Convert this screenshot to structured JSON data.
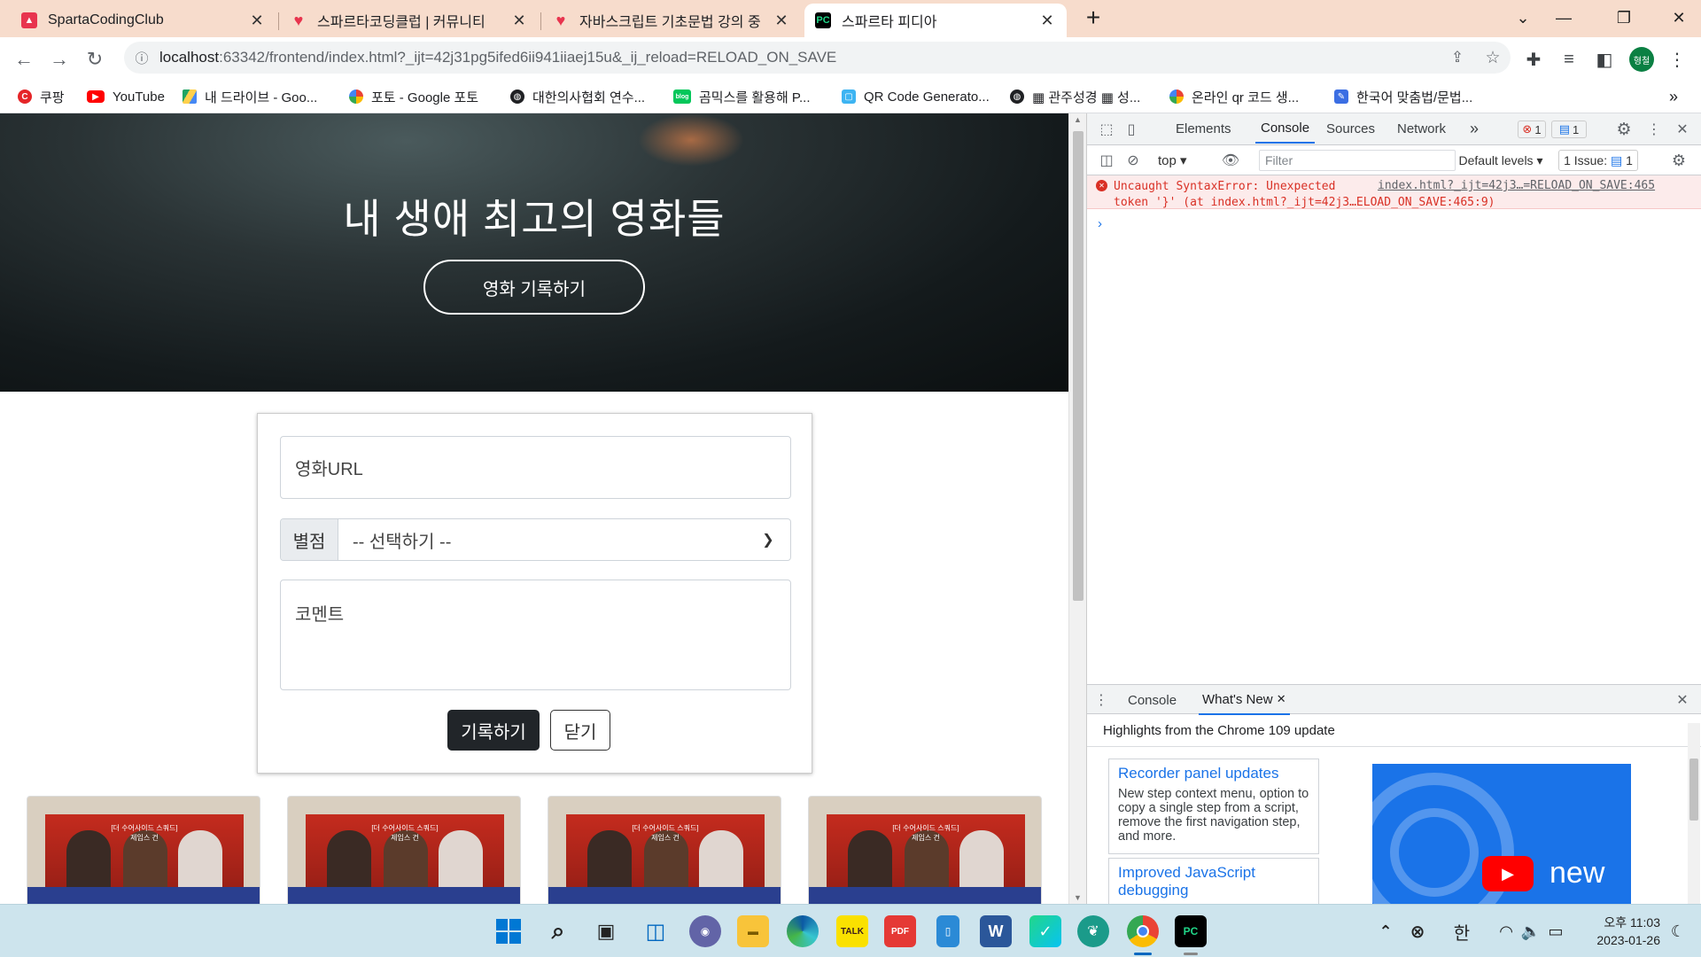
{
  "browser": {
    "tabs": [
      {
        "title": "SpartaCodingClub",
        "favicon": "sparta-icon",
        "color": "#e8344e"
      },
      {
        "title": "스파르타코딩클럽 | 커뮤니티",
        "favicon": "heart-icon",
        "color": "#e8344e"
      },
      {
        "title": "자바스크립트 기초문법 강의 중",
        "favicon": "heart-icon",
        "color": "#e8344e"
      },
      {
        "title": "스파르타 피디아",
        "favicon": "pycharm-icon",
        "color": "#21d789"
      }
    ],
    "new_tab": "+",
    "url_host": "localhost",
    "url_rest": ":63342/frontend/index.html?_ijt=42j31pg5ifed6ii941iiaej15u&_ij_reload=RELOAD_ON_SAVE",
    "profile_initial": "형철",
    "bookmarks": [
      {
        "label": "쿠팡",
        "icon": "coupang-icon",
        "color": "#e52528"
      },
      {
        "label": "YouTube",
        "icon": "youtube-icon",
        "color": "#ff0000"
      },
      {
        "label": "내 드라이브 - Goo...",
        "icon": "drive-icon",
        "color": "#1fa463"
      },
      {
        "label": "포토 - Google 포토",
        "icon": "photos-icon",
        "color": "#fbbc04"
      },
      {
        "label": "대한의사협회 연수...",
        "icon": "globe-icon",
        "color": "#202124"
      },
      {
        "label": "곰믹스를 활용해 P...",
        "icon": "blog-icon",
        "color": "#03c75a"
      },
      {
        "label": "QR Code Generato...",
        "icon": "qr-icon",
        "color": "#3db4f2"
      },
      {
        "label": "▦ 관주성경 ▦ 성...",
        "icon": "globe-icon",
        "color": "#202124"
      },
      {
        "label": "온라인 qr 코드 생...",
        "icon": "qr-flower-icon",
        "color": "#ea4335"
      },
      {
        "label": "한국어 맞춤법/문법...",
        "icon": "spell-icon",
        "color": "#3b6ee3"
      }
    ],
    "bookmarks_more": "»"
  },
  "page": {
    "hero_title": "내 생애 최고의 영화들",
    "hero_button": "영화 기록하기",
    "form": {
      "url_placeholder": "영화URL",
      "star_label": "별점",
      "star_selected": "-- 선택하기 --",
      "comment_placeholder": "코멘트",
      "save_button": "기록하기",
      "close_button": "닫기"
    },
    "poster_text": "[더 수어사이드 스쿼드] 제임스 건"
  },
  "devtools": {
    "tabs": [
      "Elements",
      "Console",
      "Sources",
      "Network"
    ],
    "active_tab": "Console",
    "more": "»",
    "error_count": "1",
    "message_count": "1",
    "context": "top",
    "filter_placeholder": "Filter",
    "levels": "Default levels",
    "issues_label": "1 Issue:",
    "issues_count": "1",
    "error_message": "Uncaught SyntaxError: Unexpected\ntoken '}' (at index.html?_ijt=42j3…ELOAD_ON_SAVE:465:9)",
    "error_source": "index.html?_ijt=42j3…=RELOAD_ON_SAVE:465",
    "drawer_tabs": [
      "Console",
      "What's New"
    ],
    "drawer_heading": "Highlights from the Chrome 109 update",
    "cards": [
      {
        "title": "Recorder panel updates",
        "desc": "New step context menu, option to copy a single step from a script, remove the first navigation step, and more."
      },
      {
        "title": "Improved JavaScript debugging",
        "desc": ""
      }
    ],
    "video_badge": "new"
  },
  "taskbar": {
    "ime": "한",
    "time": "오후 11:03",
    "date": "2023-01-26",
    "apps": [
      "windows-start-icon",
      "search-icon",
      "task-view-icon",
      "widgets-icon",
      "teams-chat-icon",
      "file-explorer-icon",
      "edge-icon",
      "kakaotalk-icon",
      "pdf-icon",
      "phone-icon",
      "word-icon",
      "pycharm-edu-icon",
      "feather-icon",
      "chrome-icon",
      "pycharm-icon"
    ]
  }
}
